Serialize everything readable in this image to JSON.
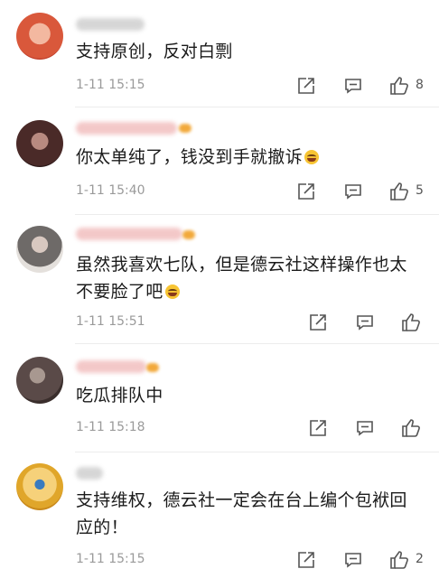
{
  "comments": [
    {
      "text": "支持原创，反对白剽",
      "time": "1-11 15:15",
      "likes": "8",
      "avatar_color": "#d9583b"
    },
    {
      "text": "你太单纯了，钱没到手就撤诉",
      "time": "1-11 15:40",
      "likes": "5",
      "avatar_color": "#4a2a28"
    },
    {
      "text_line1": "虽然我喜欢七队，但是德云社这样操作也太",
      "text_line2": "不要脸了吧",
      "time": "1-11 15:51",
      "likes": "",
      "avatar_color": "#6e6a68"
    },
    {
      "text": "吃瓜排队中",
      "time": "1-11 15:18",
      "likes": "",
      "avatar_color": "#5a4a48"
    },
    {
      "text_line1": "支持维权，德云社一定会在台上编个包袱回",
      "text_line2": "应的！",
      "time": "1-11 15:15",
      "likes": "2",
      "avatar_color": "#e0a62a"
    }
  ],
  "icons": {
    "share": "share-icon",
    "reply": "comment-reply-icon",
    "like": "thumbs-up-icon"
  }
}
